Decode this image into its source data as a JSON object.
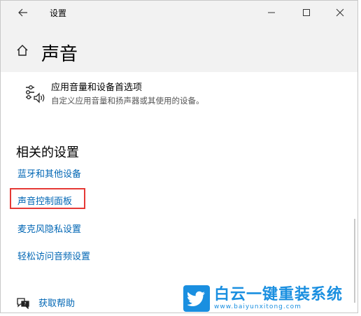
{
  "window": {
    "title": "设置",
    "back_icon": "arrow-left-icon",
    "minimize_icon": "minimize-icon",
    "maximize_icon": "maximize-icon",
    "close_icon": "close-icon"
  },
  "header": {
    "home_icon": "home-icon",
    "title": "声音"
  },
  "app_volume": {
    "icon": "sliders-speaker-icon",
    "title": "应用音量和设备首选项",
    "description": "自定义应用音量和扬声器或其使用的设备。"
  },
  "related": {
    "title": "相关的设置",
    "links": [
      "蓝牙和其他设备",
      "声音控制面板",
      "麦克风隐私设置",
      "轻松访问音频设置"
    ]
  },
  "help": {
    "icon": "chat-question-icon",
    "label": "获取帮助"
  },
  "watermark": {
    "name": "白云一键重装系统",
    "url": "www.baiyunxitong.com",
    "logo_icon": "twitter-bird-icon"
  },
  "colors": {
    "link": "#0066b4",
    "highlight": "#e53935",
    "header_bg": "#f2f2f2",
    "watermark": "#1a8fe0"
  }
}
